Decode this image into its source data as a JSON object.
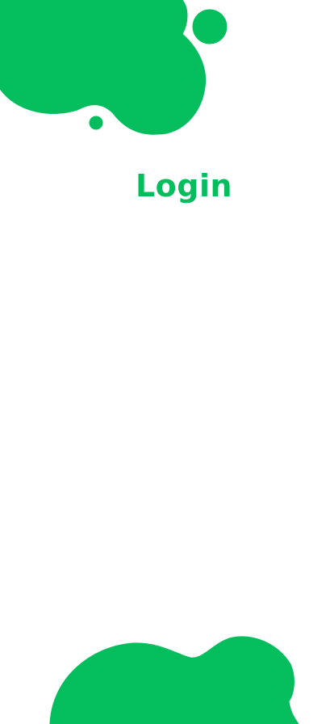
{
  "screen": {
    "title": "Login"
  },
  "colors": {
    "accent": "#04BE5E",
    "background": "#FFFFFF"
  },
  "decorations": {
    "top": "green-blob-cluster",
    "bottom": "green-blob"
  }
}
